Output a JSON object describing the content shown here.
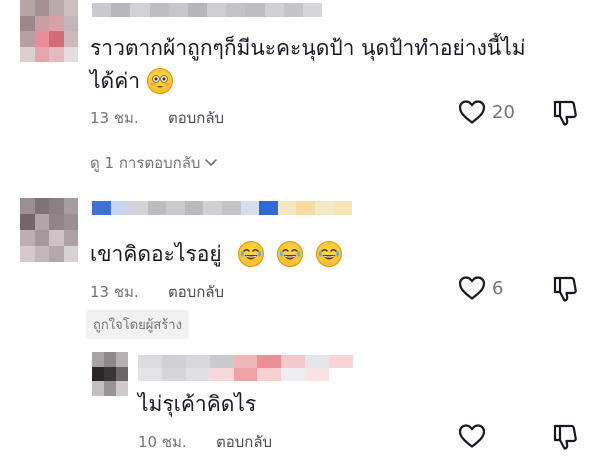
{
  "comments": [
    {
      "text_line1": "ราวตากผ้าถูกๆก็มีนะคะนุดป้า นุดป้าทำอย่างนี้ไม่",
      "text_line2": "ได้ค่า",
      "emoji": "flushed-face-emoji",
      "time": "13 ชม.",
      "reply_label": "ตอบกลับ",
      "likes": "20",
      "view_replies": "ดู 1 การตอบกลับ"
    },
    {
      "text": "เขาคิดอะไรอยู่",
      "emoji": "tears-of-joy-emoji",
      "time": "13 ชม.",
      "reply_label": "ตอบกลับ",
      "likes": "6",
      "badge": "ถูกใจโดยผู้สร้าง"
    },
    {
      "text": "ไม่รุเค้าคิดไร",
      "time": "10 ชม.",
      "reply_label": "ตอบกลับ"
    }
  ],
  "colors": {
    "text": "#161823",
    "meta": "#73747b",
    "badge_bg": "#f1f1f2",
    "icon": "#161823"
  },
  "icons": [
    "heart-outline-icon",
    "thumbs-down-icon",
    "chevron-down-icon"
  ]
}
